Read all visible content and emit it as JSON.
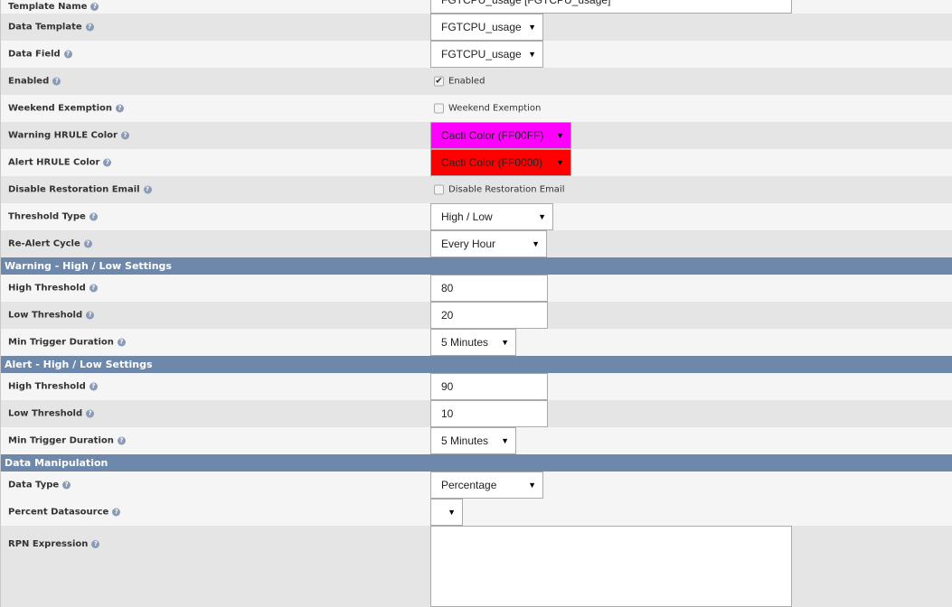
{
  "general": {
    "template_name": {
      "label": "Template Name",
      "value": "FGTCPU_usage [FGTCPU_usage]"
    },
    "data_template": {
      "label": "Data Template",
      "value": "FGTCPU_usage"
    },
    "data_field": {
      "label": "Data Field",
      "value": "FGTCPU_usage"
    },
    "enabled": {
      "label": "Enabled",
      "checkbox_label": "Enabled",
      "checked": true
    },
    "weekend": {
      "label": "Weekend Exemption",
      "checkbox_label": "Weekend Exemption",
      "checked": false
    },
    "warning_hrule": {
      "label": "Warning HRULE Color",
      "value": "Cacti Color (FF00FF)",
      "color": "#FF00FF"
    },
    "alert_hrule": {
      "label": "Alert HRULE Color",
      "value": "Cacti Color (FF0000)",
      "color": "#FF0000"
    },
    "disable_restoration": {
      "label": "Disable Restoration Email",
      "checkbox_label": "Disable Restoration Email",
      "checked": false
    },
    "threshold_type": {
      "label": "Threshold Type",
      "value": "High / Low"
    },
    "realert": {
      "label": "Re-Alert Cycle",
      "value": "Every Hour"
    }
  },
  "warning": {
    "title": "Warning - High / Low Settings",
    "high": {
      "label": "High Threshold",
      "value": "80"
    },
    "low": {
      "label": "Low Threshold",
      "value": "20"
    },
    "min": {
      "label": "Min Trigger Duration",
      "value": "5 Minutes"
    }
  },
  "alert": {
    "title": "Alert - High / Low Settings",
    "high": {
      "label": "High Threshold",
      "value": "90"
    },
    "low": {
      "label": "Low Threshold",
      "value": "10"
    },
    "min": {
      "label": "Min Trigger Duration",
      "value": "5 Minutes"
    }
  },
  "manip": {
    "title": "Data Manipulation",
    "data_type": {
      "label": "Data Type",
      "value": "Percentage"
    },
    "percent_ds": {
      "label": "Percent Datasource",
      "value": ""
    },
    "rpn": {
      "label": "RPN Expression",
      "value": ""
    }
  },
  "icons": {
    "help": "help-icon",
    "dropdown": "dropdown-arrow-icon",
    "check": "checkmark-icon"
  },
  "glyphs": {
    "help": "?",
    "arrow": "▼",
    "check": "✔"
  }
}
